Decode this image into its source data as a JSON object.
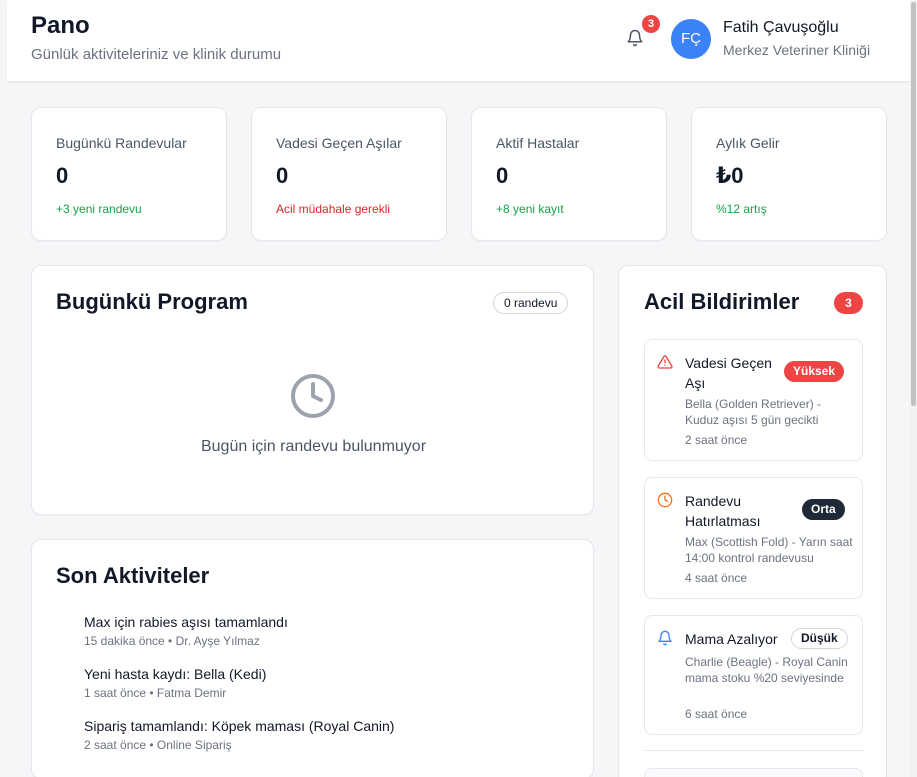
{
  "header": {
    "title": "Pano",
    "subtitle": "Günlük aktiviteleriniz ve klinik durumu",
    "notification_count": "3",
    "user": {
      "initials": "FÇ",
      "name": "Fatih Çavuşoğlu",
      "clinic": "Merkez Veteriner Kliniği"
    }
  },
  "stats": [
    {
      "label": "Bugünkü Randevular",
      "value": "0",
      "note": "+3 yeni randevu",
      "note_tone": "positive"
    },
    {
      "label": "Vadesi Geçen Aşılar",
      "value": "0",
      "note": "Acil müdahale gerekli",
      "note_tone": "negative"
    },
    {
      "label": "Aktif Hastalar",
      "value": "0",
      "note": "+8 yeni kayıt",
      "note_tone": "positive"
    },
    {
      "label": "Aylık Gelir",
      "value": "₺0",
      "note": "%12 artış",
      "note_tone": "positive"
    }
  ],
  "program": {
    "title": "Bugünkü Program",
    "badge": "0 randevu",
    "empty_text": "Bugün için randevu bulunmuyor"
  },
  "activities": {
    "title": "Son Aktiviteler",
    "items": [
      {
        "title": "Max için rabies aşısı tamamlandı",
        "meta": "15 dakika önce • Dr. Ayşe Yılmaz"
      },
      {
        "title": "Yeni hasta kaydı: Bella (Kedi)",
        "meta": "1 saat önce • Fatma Demir"
      },
      {
        "title": "Sipariş tamamlandı: Köpek maması (Royal Canin)",
        "meta": "2 saat önce • Online Sipariş"
      }
    ]
  },
  "alerts": {
    "title": "Acil Bildirimler",
    "count": "3",
    "items": [
      {
        "icon": "warning-triangle-icon",
        "icon_color": "#ef4444",
        "title": "Vadesi Geçen Aşı",
        "severity": "Yüksek",
        "description": "Bella (Golden Retriever) - Kuduz aşısı 5 gün gecikti",
        "time": "2 saat önce"
      },
      {
        "icon": "clock-icon",
        "icon_color": "#f97316",
        "title": "Randevu Hatırlatması",
        "severity": "Orta",
        "description": "Max (Scottish Fold) - Yarın saat 14:00 kontrol randevusu",
        "time": "4 saat önce"
      },
      {
        "icon": "bell-icon",
        "icon_color": "#3b82f6",
        "title": "Mama Azalıyor",
        "severity": "Düşük",
        "description": "Charlie (Beagle) - Royal Canin mama stoku %20 seviyesinde",
        "time": "6 saat önce"
      }
    ]
  },
  "colors": {
    "accent": "#3b82f6",
    "danger": "#ef4444",
    "success": "#16a34a",
    "warning": "#f97316"
  }
}
